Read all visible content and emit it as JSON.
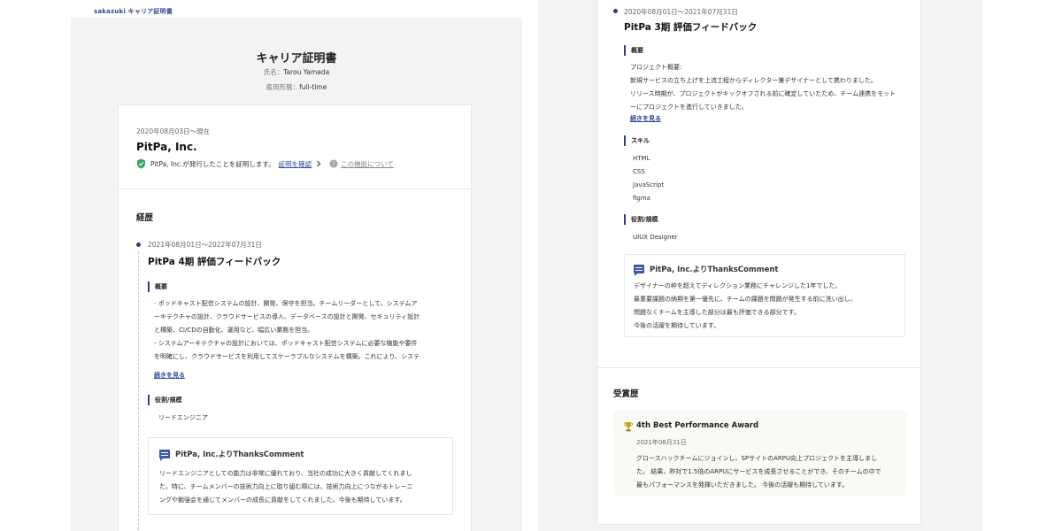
{
  "brand": {
    "logo_text": "sakazuki",
    "logo_suffix": "キャリア証明書"
  },
  "document": {
    "title": "キャリア証明書",
    "name_label": "氏名",
    "name_value": "Tarou Yamada",
    "type_label": "雇用形態",
    "type_value": "full-time"
  },
  "company": {
    "period": "2020年08月03日〜現在",
    "name": "PitPa, Inc.",
    "verify_text": "PitPa, Inc.が発行したことを証明します。",
    "verify_link": "証明を確認",
    "about_link": "この機能について"
  },
  "career": {
    "section_title": "経歴",
    "entries": [
      {
        "period": "2021年08月01日〜2022年07月31日",
        "title": "PitPa 4期 評価フィードバック",
        "overview_label": "概要",
        "overview_lines": [
          "- ポッドキャスト配信システムの設計、開発、保守を担当。チームリーダーとして、システムア",
          "ーキテクチャの設計、クラウドサービスの導入、データベースの設計と開発、セキュリティ設計",
          "と構築、CI/CDの自動化、運用など、幅広い業務を担当。",
          "- システムアーキテクチャの設計においては、ポッドキャスト配信システムに必要な機能や要件",
          "を明確にし、クラウドサービスを利用してスケーラブルなシステムを構築。これにより、システ"
        ],
        "more_link": "続きを見る",
        "role_label": "役割/規模",
        "role_value": "リードエンジニア",
        "thanks_title": "PitPa, Inc.よりThanksComment",
        "thanks_lines": [
          "リードエンジニアとしての能力は非常に優れており、当社の成功に大きく貢献してくれまし",
          "た。特に、チームメンバーの技術力向上に取り組む際には、技術力向上につながるトレーニ",
          "ングや勉強会を通じてメンバーの成長に貢献をしてくれました。今後も期待しています。"
        ]
      },
      {
        "period": "2020年08月01日〜2021年07月31日",
        "title": "PitPa 3期 評価フィードバック",
        "overview_label": "概要",
        "overview_lines": [
          "プロジェクト概要:",
          "新規サービスの立ち上げを上流工程からディレクター兼デザイナーとして携わりました。",
          "リリース時期が、プロジェクトがキックオフされる前に確定していたため、チーム連携をモット",
          "ーにプロジェクトを進行していきました。"
        ],
        "more_link": "続きを見る",
        "skills_label": "スキル",
        "skills": [
          "HTML",
          "CSS",
          "JavaScript",
          "figma"
        ],
        "role_label": "役割/規模",
        "role_value": "UIUX Designer",
        "thanks_title": "PitPa, Inc.よりThanksComment",
        "thanks_lines": [
          "デザイナーの枠を超えてディレクション業務にチャレンジした1年でした。",
          "最重要課題の納期を第一優先に、チームの課題を問題が発生する前に洗い出し、",
          "問題なくチームを主導した部分は最も評価できる部分です。",
          "今後の活躍を期待しています。"
        ]
      }
    ]
  },
  "awards": {
    "section_title": "受賞歴",
    "items": [
      {
        "title": "4th Best Performance Award",
        "date": "2021年08月31日",
        "lines": [
          "グロースハックチームにジョインし、SPサイトのARPU向上プロジェクトを主導しまし",
          "た。 結果、昨対で1.5倍のARPUにサービスを成長させることができ、そのチームの中で",
          "最もパフォーマンスを発揮いただきました。 今後の活躍も期待しています。"
        ]
      }
    ]
  },
  "colors": {
    "accent": "#2a3d8f",
    "link": "#2f4aa0",
    "verified": "#3aa55a",
    "trophy": "#c9a227"
  },
  "icons": [
    "shield-check-icon",
    "chevron-right-icon",
    "help-circle-icon",
    "chat-icon",
    "trophy-icon"
  ]
}
